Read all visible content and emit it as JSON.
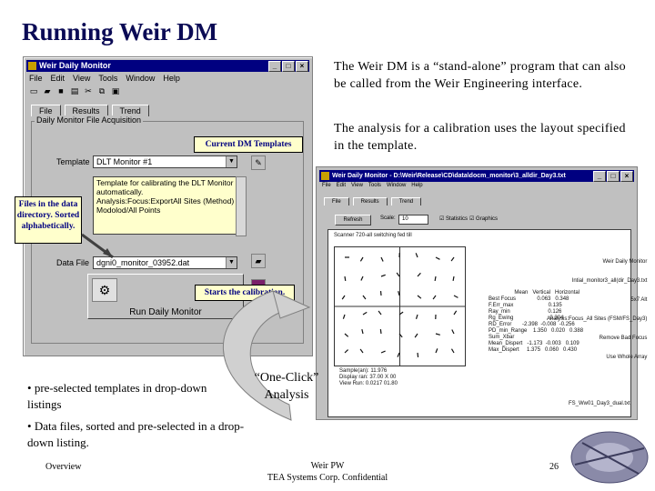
{
  "slide": {
    "title": "Running Weir DM",
    "intro_paragraph": "The Weir DM is a “stand-alone” program that can also be called from the Weir Engineering interface.",
    "template_paragraph": "The analysis for a calibration uses the layout specified in the template.",
    "bullets": [
      "pre-selected templates in drop-down listings",
      "Data files, sorted and pre-selected in a drop-down listing."
    ],
    "one_click_label": "“One-Click” Analysis"
  },
  "callouts": {
    "current_templates": "Current DM Templates",
    "files_in_directory": "Files in the data directory. Sorted alphabetically.",
    "starts_calibration": "Starts the calibration."
  },
  "app_window": {
    "title": "Weir Daily Monitor",
    "menu": [
      "File",
      "Edit",
      "View",
      "Tools",
      "Window",
      "Help"
    ],
    "tabs": [
      "File",
      "Results",
      "Trend"
    ],
    "group_label": "Daily Monitor File Acquisition",
    "template_label": "Template",
    "template_value": "DLT Monitor #1",
    "description_lines": [
      "Template for calibrating the DLT Monitor",
      "automatically.",
      "Analysis:Focus:ExportAll Sites (Method)",
      "Modolod/All Points"
    ],
    "data_file_label": "Data File",
    "data_file_value": "dgni0_monitor_03952.dat",
    "run_button": "Run Daily Monitor"
  },
  "result_window": {
    "title": "Weir Daily Monitor - D:\\Weir\\Release\\CD\\data\\docm_monitor\\3_alldir_Day3.txt",
    "menu": [
      "File",
      "Edit",
      "View",
      "Tools",
      "Window",
      "Help"
    ],
    "tabs": [
      "File",
      "Results",
      "Trend"
    ],
    "refresh_button": "Refresh",
    "scale_label": "Scale:",
    "scale_value": "10",
    "statistics_label": "Statistics",
    "graphics_label": "Graphics",
    "scanner_line": "Scanner 720-all switching fed till",
    "readout_lines": [
      "Weir Daily Monitor",
      "Intial_monitor3_all(dir_Day3.txt",
      "5x7 Alt",
      "Analysis:Focus_All Sites (FSM/FS_Day3)",
      "Remove Bad Focus",
      "Use Whole Array"
    ],
    "table_header": [
      "Mean",
      "Vertical",
      "Horizontal"
    ],
    "table_rows": [
      [
        "Best Focus",
        "",
        "0.063",
        "0.348"
      ],
      [
        "F.Err_max",
        "",
        "",
        "0.135"
      ],
      [
        "Ray_min",
        "",
        "",
        "0.126"
      ],
      [
        "Rg_Ewing",
        "",
        "",
        "0.304"
      ],
      [
        "RD_Error",
        "-2.398",
        "-0.008",
        "-0.256"
      ],
      [
        "PD_min_Range",
        "1.350",
        "0.020",
        "0.388"
      ],
      [
        "Sum_Xbar",
        "",
        "",
        ""
      ],
      [
        "Mean_Dispert",
        "-1.173",
        "-0.003",
        "0.109"
      ],
      [
        "Max_Dispert",
        "1.375",
        "0.060",
        "0.430"
      ]
    ],
    "sample_text": "Sample(an): 11.976\nDisplay ran: 37.00 X 00\nView Run: 0.0217 01.80",
    "footer_right": "FS_Ww01_Day3_dual.txt"
  },
  "footer": {
    "left": "Overview",
    "center_top": "Weir PW",
    "center_bottom": "TEA Systems Corp. Confidential",
    "page_number": "26"
  },
  "colors": {
    "title": "#0b0b55",
    "windows_blue": "#000080",
    "callout_fill": "#ffffcc"
  }
}
